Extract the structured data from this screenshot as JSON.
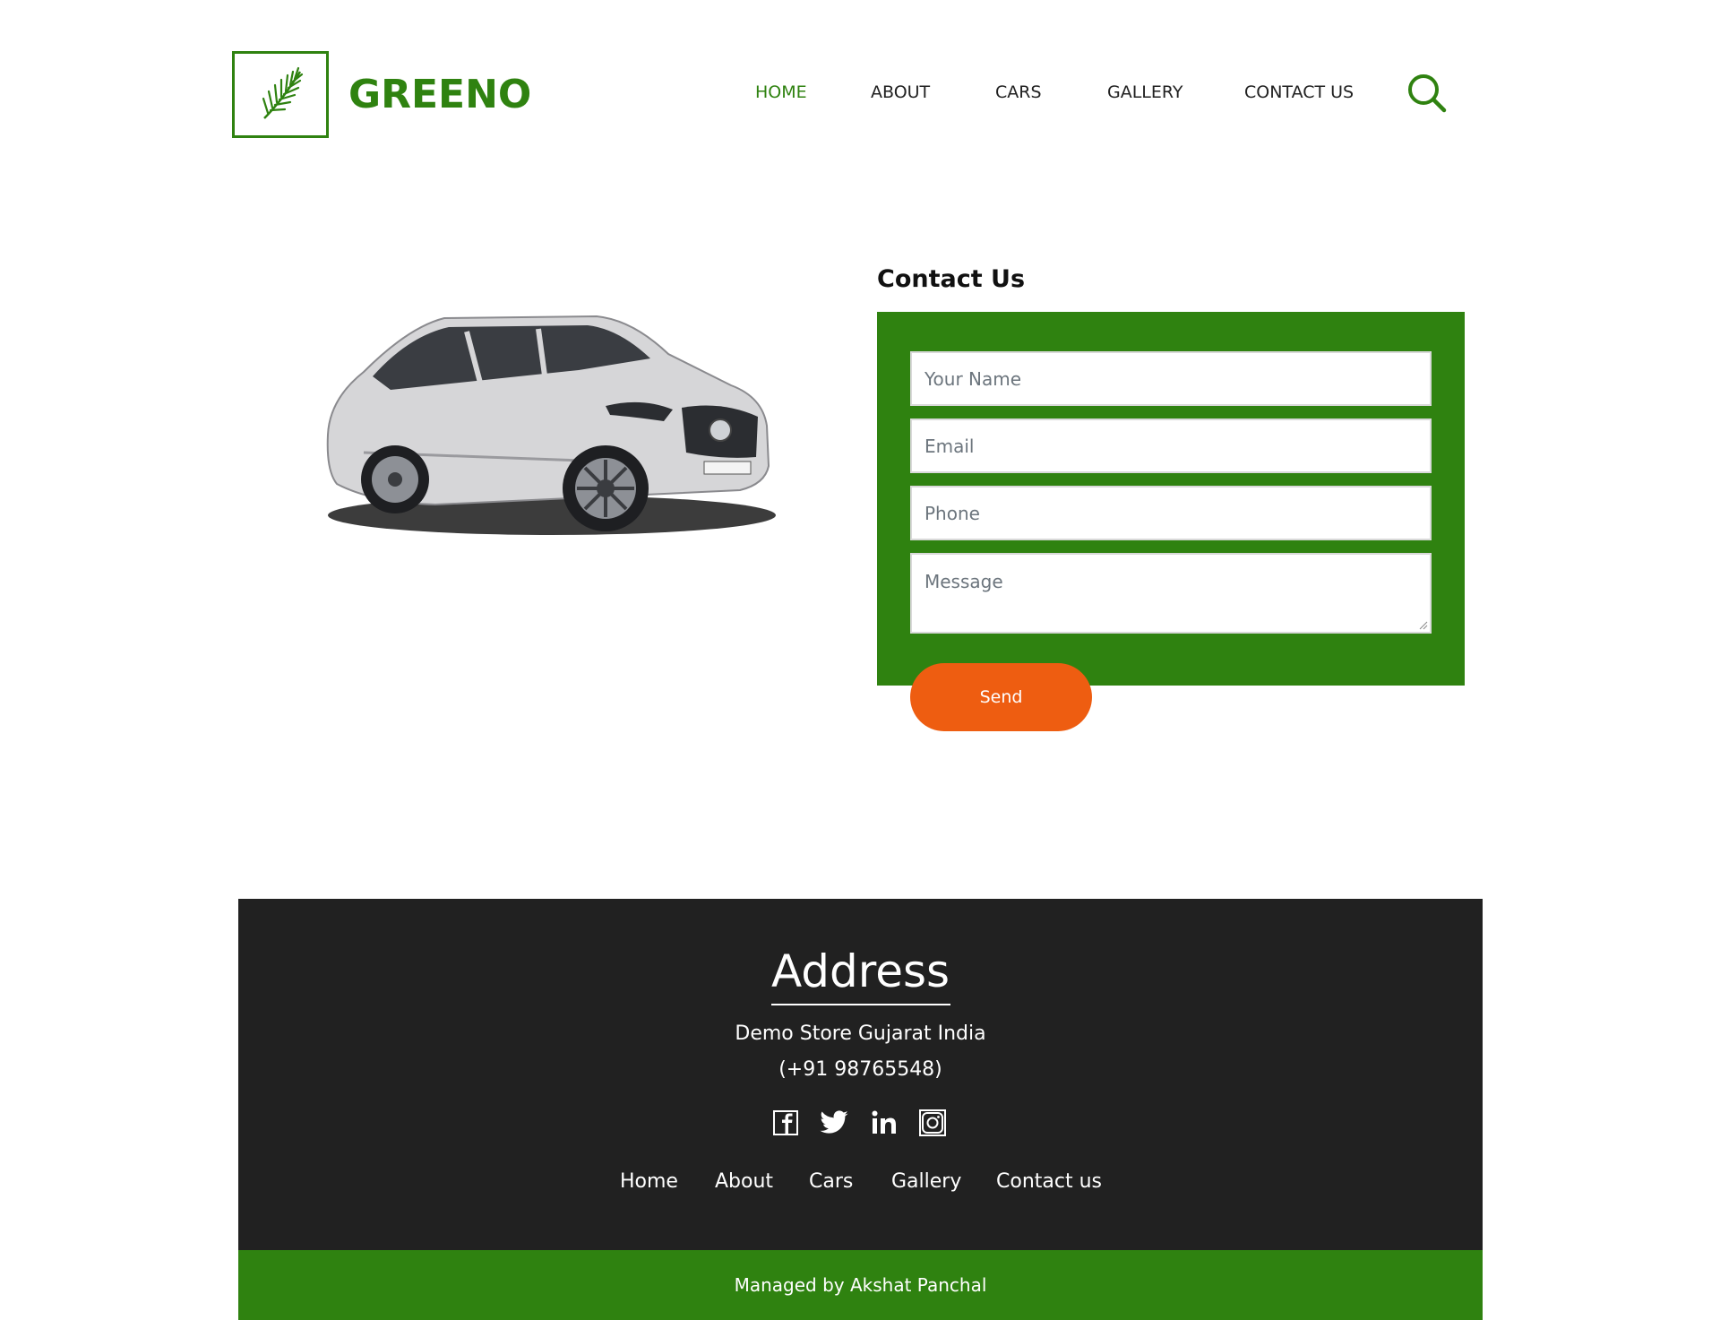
{
  "brand": {
    "name": "GREENO",
    "logo_icon": "palm-leaf-icon"
  },
  "nav": {
    "items": [
      {
        "label": "HOME",
        "active": true
      },
      {
        "label": "ABOUT",
        "active": false
      },
      {
        "label": "CARS",
        "active": false
      },
      {
        "label": "GALLERY",
        "active": false
      },
      {
        "label": "CONTACT US",
        "active": false
      }
    ],
    "search_icon": "search-icon"
  },
  "contact": {
    "title": "Contact Us",
    "name_placeholder": "Your Name",
    "email_placeholder": "Email",
    "phone_placeholder": "Phone",
    "message_placeholder": "Message",
    "send_label": "Send"
  },
  "footer": {
    "title": "Address",
    "address": "Demo Store Gujarat India",
    "phone": "(+91 98765548)",
    "social": [
      "facebook-icon",
      "twitter-icon",
      "linkedin-icon",
      "instagram-icon"
    ],
    "links": [
      "Home",
      "About",
      "Cars",
      "Gallery",
      "Contact us"
    ],
    "credit": "Managed by Akshat Panchal"
  },
  "colors": {
    "brand_green": "#2f8210",
    "send_orange": "#ee5d11",
    "footer_dark": "#212121"
  }
}
